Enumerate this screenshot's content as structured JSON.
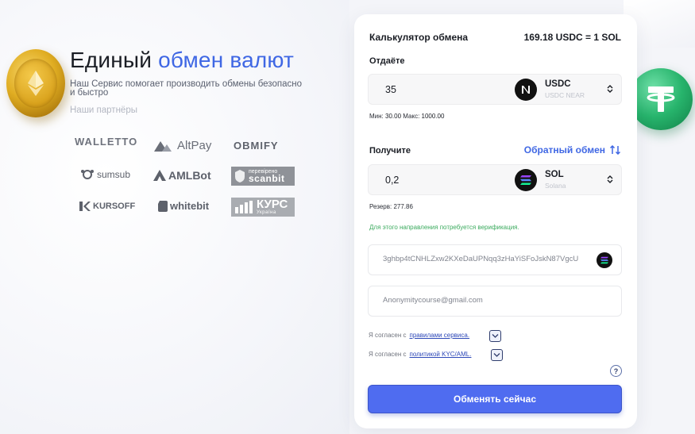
{
  "hero": {
    "title_plain": "Единый",
    "title_accent": "обмен валют",
    "subtitle": "Наш Сервис помогает производить обмены безопасно и быстро",
    "partners_title": "Наши партнёры"
  },
  "partners": [
    {
      "name": "WALLETTO"
    },
    {
      "name": "AltPay"
    },
    {
      "name": "OBMIFY"
    },
    {
      "name": "sumsub"
    },
    {
      "name": "AMLBot"
    },
    {
      "name_small": "перевірено",
      "name": "scanbit"
    },
    {
      "name": "KURSOFF"
    },
    {
      "name": "whitebit"
    },
    {
      "name": "КУРС",
      "name_small": "Україна"
    }
  ],
  "calculator": {
    "title": "Калькулятор обмена",
    "rate": "169.18 USDC = 1 SOL",
    "give": {
      "label": "Отдаёте",
      "amount": "35",
      "coin": "USDC",
      "network": "USDC NEAR",
      "min_label": "Мин:",
      "min_value": "30.00",
      "max_label": "Макс:",
      "max_value": "1000.00"
    },
    "get": {
      "label": "Получите",
      "reverse_label": "Обратный обмен",
      "amount": "0,2",
      "coin": "SOL",
      "network": "Solana",
      "reserve_label": "Резерв:",
      "reserve_value": "277.86"
    },
    "verification_note": "Для этого направления потребуется верификация.",
    "wallet_value": "3ghbp4tCNHLZxw2KXeDaUPNqq3zHaYiSFoJskN87VgcU",
    "email_value": "Anonymitycourse@gmail.com",
    "agree_rules_text": "Я согласен с",
    "agree_rules_link": "правилами сервиса.",
    "agree_kyc_text": "Я согласен с",
    "agree_kyc_link": "политикой KYC/AML.",
    "help_label": "?",
    "submit_label": "Обменять сейчас"
  },
  "colors": {
    "accent": "#3f67e4",
    "button": "#4f6cf0",
    "success": "#3cab5f",
    "link": "#2e49b8"
  }
}
